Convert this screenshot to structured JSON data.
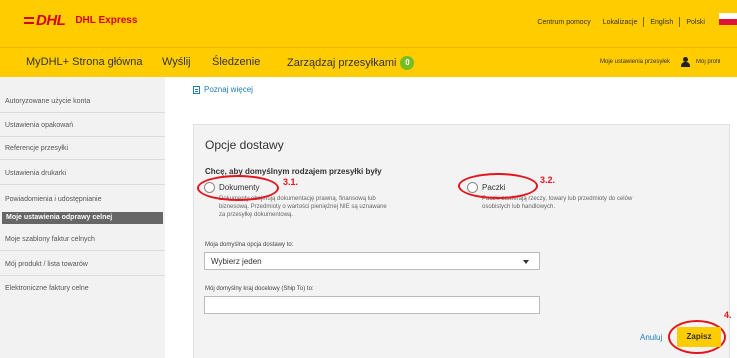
{
  "header": {
    "brand": "DHL",
    "brand_name": "DHL Express",
    "links": [
      "Centrum pomocy",
      "Lokalizacje",
      "English",
      "Polski"
    ]
  },
  "nav": {
    "home": "MyDHL+ Strona główna",
    "send": "Wyślij",
    "track": "Śledzenie",
    "manage": "Zarządzaj przesyłkami",
    "manage_count": "0",
    "settings": "Moje ustawienia przesyłek",
    "profile": "Mój profil"
  },
  "sidebar": {
    "items": [
      {
        "label": "Autoryzowane użycie konta"
      },
      {
        "label": "Ustawienia opakowań"
      },
      {
        "label": "Referencje przesyłki"
      },
      {
        "label": "Ustawienia drukarki"
      },
      {
        "label": "Powiadomienia i udostępnianie"
      },
      {
        "label": "Moje ustawienia odprawy celnej"
      },
      {
        "label": "Moje szablony faktur celnych"
      },
      {
        "label": "Mój produkt / lista towarów"
      },
      {
        "label": "Elektroniczne faktury celne"
      }
    ],
    "active_index": 5
  },
  "content": {
    "learn_more": "Poznaj więcej",
    "panel_title": "Opcje dostawy",
    "question": "Chcę, aby domyślnym rodzajem przesyłki były",
    "options": [
      {
        "label": "Dokumenty",
        "description": "Dokumenty obejmują dokumentację prawną, finansową lub biznesową. Przedmioty o wartości pieniężnej NIE są uznawane za przesyłkę dokumentową.",
        "desc_lines": [
          "Dokumenty obejmują dokumentację prawną, finansową lub",
          "biznesową. Przedmioty o wartości pieniężnej NIE są uznawane",
          "za przesyłkę dokumentową."
        ],
        "marker": "3.1."
      },
      {
        "label": "Paczki",
        "description": "Paczki zawierają rzeczy, towary lub przedmioty do celów osobistych lub handlowych.",
        "desc_lines": [
          "Paczki zawierają rzeczy, towary lub przedmioty do celów",
          "osobistych lub handlowych."
        ],
        "marker": "3.2."
      }
    ],
    "delivery_option_label": "Moja domyślna opcja dostawy to:",
    "delivery_option_value": "Wybierz jeden",
    "destination_label": "Mój domyślny kraj docelowy (Ship To) to:",
    "destination_value": "",
    "cancel": "Anuluj",
    "save": "Zapisz",
    "save_marker": "4."
  },
  "colors": {
    "dhl_yellow": "#ffcc00",
    "dhl_red": "#d40511",
    "annotation_red": "#e3141c",
    "link_blue": "#1e7bbd",
    "badge_green": "#76bd22"
  }
}
